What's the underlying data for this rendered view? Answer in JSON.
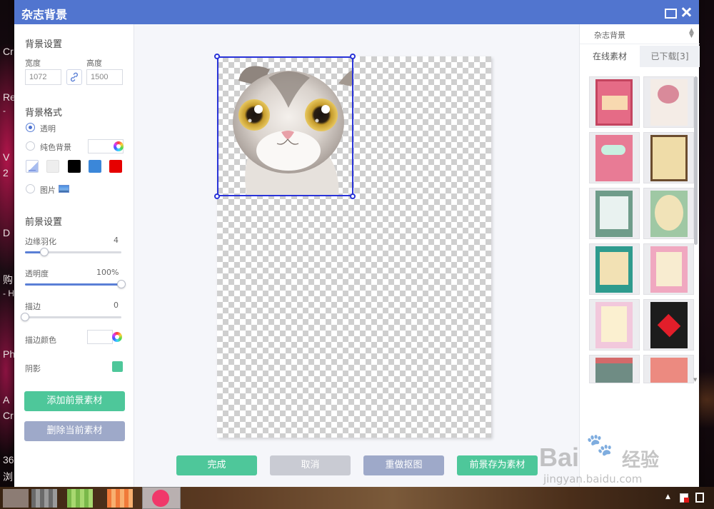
{
  "window": {
    "title": "杂志背景"
  },
  "left": {
    "bg_title": "背景设置",
    "width_label": "宽度",
    "width_value": "1072",
    "height_label": "高度",
    "height_value": "1500",
    "format_title": "背景格式",
    "opt_transparent": "透明",
    "opt_solid": "纯色背景",
    "opt_image": "图片",
    "swatches": [
      "#eeeeee",
      "#000000",
      "#3b87d9",
      "#e60000"
    ],
    "fg_title": "前景设置",
    "feather_label": "边缘羽化",
    "feather_value": "4",
    "feather_level": 0.2,
    "opacity_label": "透明度",
    "opacity_value": "100%",
    "opacity_level": 1.0,
    "stroke_label": "描边",
    "stroke_value": "0",
    "stroke_level": 0,
    "stroke_color_label": "描边颜色",
    "shadow_label": "阴影",
    "shadow_color": "#4ec79a",
    "add_btn": "添加前景素材",
    "del_btn": "删除当前素材"
  },
  "bottom": {
    "done": "完成",
    "cancel": "取消",
    "redo": "重做抠图",
    "save": "前景存为素材"
  },
  "right": {
    "category": "杂志背景",
    "tab_online": "在线素材",
    "tab_downloaded": "已下载[3]"
  },
  "desktop": {
    "fragments": [
      "Cr",
      "Re",
      "-",
      "V",
      "2",
      "D",
      "购",
      "- H",
      "Ph",
      "A",
      "Cr",
      "36",
      "浏"
    ]
  },
  "watermark": {
    "brand": "Bai",
    "brand_cn": "经验",
    "url": "jingyan.baidu.com"
  }
}
